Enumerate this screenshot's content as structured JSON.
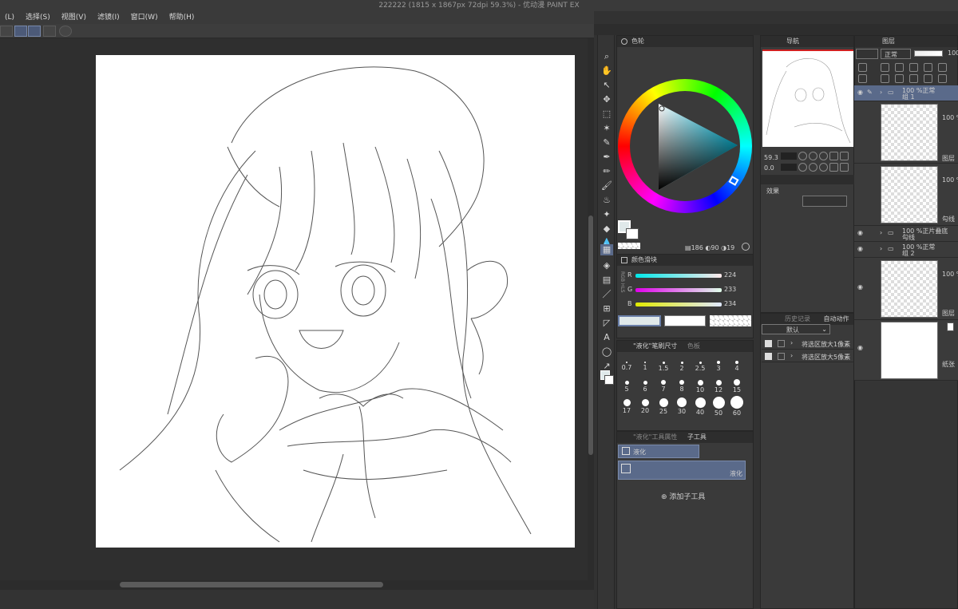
{
  "window": {
    "title": "222222 (1815 x 1867px 72dpi 59.3%)  - 优动漫 PAINT EX"
  },
  "menu": [
    {
      "label": "(L)"
    },
    {
      "label": "选择(S)"
    },
    {
      "label": "视图(V)"
    },
    {
      "label": "滤镜(I)"
    },
    {
      "label": "窗口(W)"
    },
    {
      "label": "帮助(H)"
    }
  ],
  "color_wheel_panel": {
    "title": "色轮",
    "readout": {
      "h": "186",
      "s": "90",
      "v": "19"
    }
  },
  "color_slider_panel": {
    "title": "颜色滑块",
    "side_label": "RGB HLS",
    "r_label": "R",
    "r_value": "224",
    "g_label": "G",
    "g_value": "233",
    "b_label": "B",
    "b_value": "234"
  },
  "brush_size_panel": {
    "tab_label": "\"液化\"笔刷尺寸",
    "tab2_label": "色板",
    "sizes": [
      "0.7",
      "1",
      "1.5",
      "2",
      "2.5",
      "3",
      "4",
      "5",
      "6",
      "7",
      "8",
      "10",
      "12",
      "15",
      "17",
      "20",
      "25",
      "30",
      "40",
      "50",
      "60"
    ]
  },
  "subtool_panel": {
    "tab1_label": "\"液化\"工具属性",
    "tab2_label": "子工具",
    "item_label": "液化",
    "selected_label": "液化",
    "add_label": "添加子工具"
  },
  "navigator_panel": {
    "tab_label": "导航",
    "zoom": "59.3",
    "angle": "0.0",
    "effects_label": "效果"
  },
  "history_panel": {
    "tab1_label": "历史记录",
    "tab2_label": "自动动作",
    "set_name": "默认",
    "actions": [
      {
        "label": "将选区放大1像素"
      },
      {
        "label": "将选区放大5像素"
      }
    ]
  },
  "layer_panel": {
    "tab_label": "图层",
    "blend_mode": "正常",
    "opacity": "100",
    "layers": [
      {
        "line1": "100 %正常",
        "line2": "组 1"
      },
      {
        "line1": "100 %",
        "line2": "图层"
      },
      {
        "line1": "100 %",
        "line2": "勾线"
      },
      {
        "line1": "100 %正片叠底",
        "line2": "勾线"
      },
      {
        "line1": "100 %正常",
        "line2": "组 2"
      },
      {
        "line1": "100 %",
        "line2": "图层"
      },
      {
        "line1": "",
        "line2": "纸张"
      }
    ]
  },
  "colors": {
    "main_color": "#e0e9ea",
    "accent": "#5a6a8a"
  }
}
